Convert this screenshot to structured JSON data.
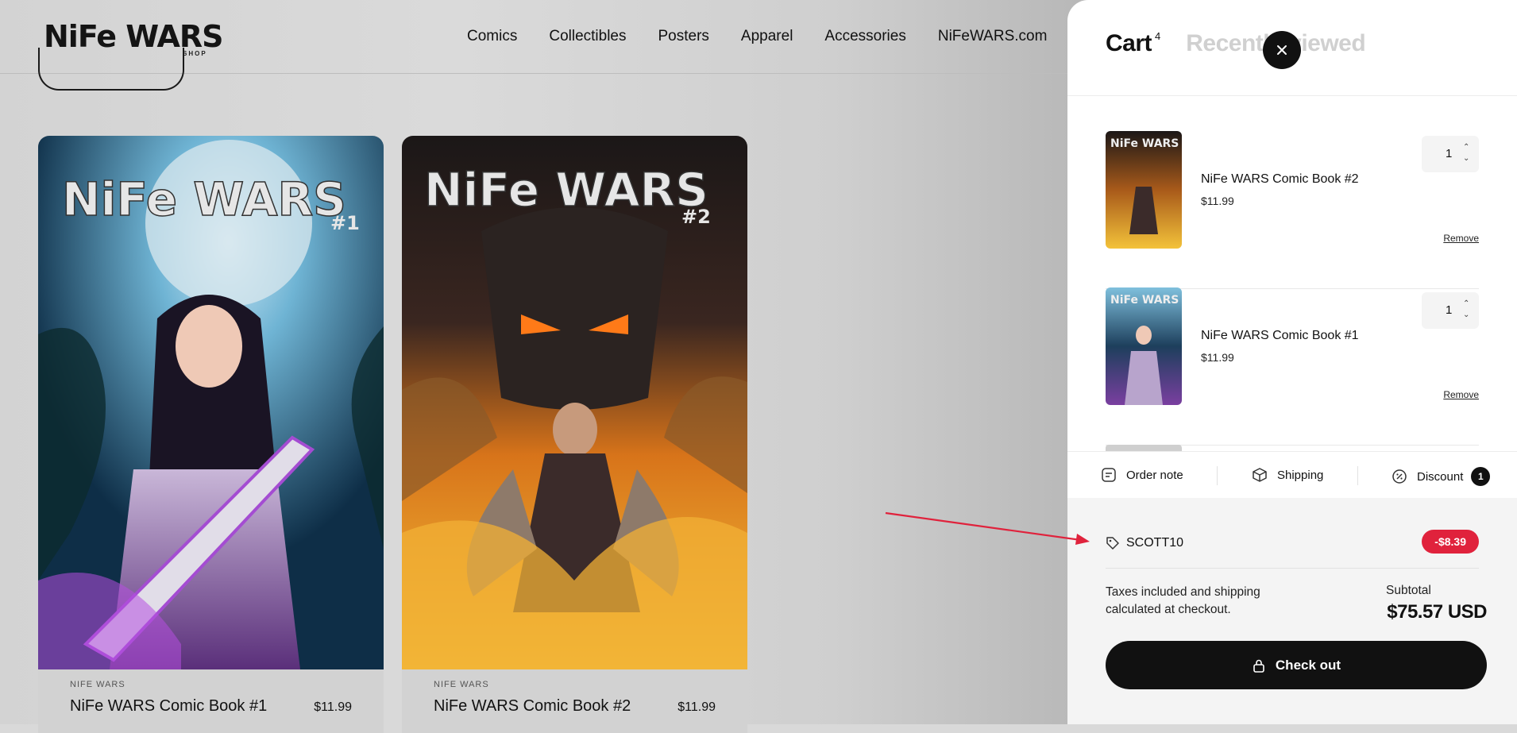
{
  "header": {
    "logo_text": "NiFe WARS",
    "logo_sub": "SHOP",
    "nav": [
      "Comics",
      "Collectibles",
      "Posters",
      "Apparel",
      "Accessories",
      "NiFeWARS.com"
    ]
  },
  "products": [
    {
      "brand": "NIFE WARS",
      "title": "NiFe WARS Comic Book #1",
      "price": "$11.99",
      "cover_title": "NiFe WARS",
      "cover_issue": "#1"
    },
    {
      "brand": "NIFE WARS",
      "title": "NiFe WARS Comic Book #2",
      "price": "$11.99",
      "cover_title": "NiFe WARS",
      "cover_issue": "#2"
    }
  ],
  "cart": {
    "tab_cart": "Cart",
    "tab_count": "4",
    "tab_recent": "Recently viewed",
    "items": [
      {
        "name": "NiFe WARS Comic Book #2",
        "price": "$11.99",
        "qty": "1",
        "remove": "Remove"
      },
      {
        "name": "NiFe WARS Comic Book #1",
        "price": "$11.99",
        "qty": "1",
        "remove": "Remove"
      }
    ],
    "toolbar": {
      "order_note": "Order note",
      "shipping": "Shipping",
      "discount": "Discount",
      "discount_count": "1"
    },
    "discount_code": "SCOTT10",
    "discount_amount": "-$8.39",
    "tax_note": "Taxes included and shipping calculated at checkout.",
    "subtotal_label": "Subtotal",
    "subtotal_value": "$75.57 USD",
    "checkout_label": "Check out"
  },
  "colors": {
    "accent_red": "#e0223c",
    "dark": "#111111"
  }
}
